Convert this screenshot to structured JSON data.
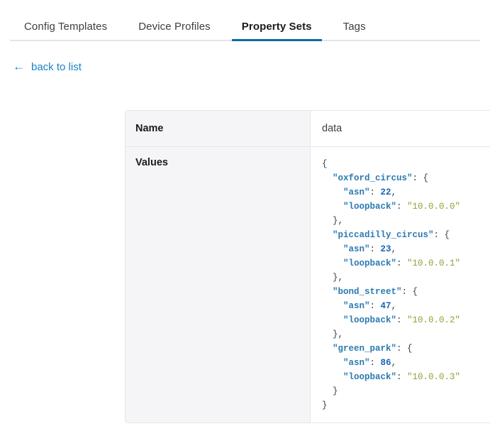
{
  "tabs": [
    {
      "label": "Config Templates",
      "active": false
    },
    {
      "label": "Device Profiles",
      "active": false
    },
    {
      "label": "Property Sets",
      "active": true
    },
    {
      "label": "Tags",
      "active": false
    }
  ],
  "back_link": {
    "label": "back to list",
    "icon": "arrow-left-icon",
    "glyph": "←"
  },
  "table": {
    "headers": {
      "name": "Name",
      "data": "data"
    },
    "row_label": "Values",
    "json_lines": [
      [
        {
          "t": "punct",
          "v": "{"
        }
      ],
      [
        {
          "t": "punct",
          "v": "  "
        },
        {
          "t": "key",
          "v": "\"oxford_circus\""
        },
        {
          "t": "punct",
          "v": ": {"
        }
      ],
      [
        {
          "t": "punct",
          "v": "    "
        },
        {
          "t": "key",
          "v": "\"asn\""
        },
        {
          "t": "punct",
          "v": ": "
        },
        {
          "t": "num",
          "v": "22"
        },
        {
          "t": "punct",
          "v": ","
        }
      ],
      [
        {
          "t": "punct",
          "v": "    "
        },
        {
          "t": "key",
          "v": "\"loopback\""
        },
        {
          "t": "punct",
          "v": ": "
        },
        {
          "t": "str",
          "v": "\"10.0.0.0\""
        }
      ],
      [
        {
          "t": "punct",
          "v": "  },"
        }
      ],
      [
        {
          "t": "punct",
          "v": "  "
        },
        {
          "t": "key",
          "v": "\"piccadilly_circus\""
        },
        {
          "t": "punct",
          "v": ": {"
        }
      ],
      [
        {
          "t": "punct",
          "v": "    "
        },
        {
          "t": "key",
          "v": "\"asn\""
        },
        {
          "t": "punct",
          "v": ": "
        },
        {
          "t": "num",
          "v": "23"
        },
        {
          "t": "punct",
          "v": ","
        }
      ],
      [
        {
          "t": "punct",
          "v": "    "
        },
        {
          "t": "key",
          "v": "\"loopback\""
        },
        {
          "t": "punct",
          "v": ": "
        },
        {
          "t": "str",
          "v": "\"10.0.0.1\""
        }
      ],
      [
        {
          "t": "punct",
          "v": "  },"
        }
      ],
      [
        {
          "t": "punct",
          "v": "  "
        },
        {
          "t": "key",
          "v": "\"bond_street\""
        },
        {
          "t": "punct",
          "v": ": {"
        }
      ],
      [
        {
          "t": "punct",
          "v": "    "
        },
        {
          "t": "key",
          "v": "\"asn\""
        },
        {
          "t": "punct",
          "v": ": "
        },
        {
          "t": "num",
          "v": "47"
        },
        {
          "t": "punct",
          "v": ","
        }
      ],
      [
        {
          "t": "punct",
          "v": "    "
        },
        {
          "t": "key",
          "v": "\"loopback\""
        },
        {
          "t": "punct",
          "v": ": "
        },
        {
          "t": "str",
          "v": "\"10.0.0.2\""
        }
      ],
      [
        {
          "t": "punct",
          "v": "  },"
        }
      ],
      [
        {
          "t": "punct",
          "v": "  "
        },
        {
          "t": "key",
          "v": "\"green_park\""
        },
        {
          "t": "punct",
          "v": ": {"
        }
      ],
      [
        {
          "t": "punct",
          "v": "    "
        },
        {
          "t": "key",
          "v": "\"asn\""
        },
        {
          "t": "punct",
          "v": ": "
        },
        {
          "t": "num",
          "v": "86"
        },
        {
          "t": "punct",
          "v": ","
        }
      ],
      [
        {
          "t": "punct",
          "v": "    "
        },
        {
          "t": "key",
          "v": "\"loopback\""
        },
        {
          "t": "punct",
          "v": ": "
        },
        {
          "t": "str",
          "v": "\"10.0.0.3\""
        }
      ],
      [
        {
          "t": "punct",
          "v": "  }"
        }
      ],
      [
        {
          "t": "punct",
          "v": "}"
        }
      ]
    ]
  },
  "colors": {
    "accent": "#0b6ba4",
    "link": "#1b82c4",
    "json_key": "#2b7ab0",
    "json_number": "#1a63b8",
    "json_string": "#8fa336",
    "header_bg": "#f5f5f7",
    "border": "#e6e6ec"
  }
}
